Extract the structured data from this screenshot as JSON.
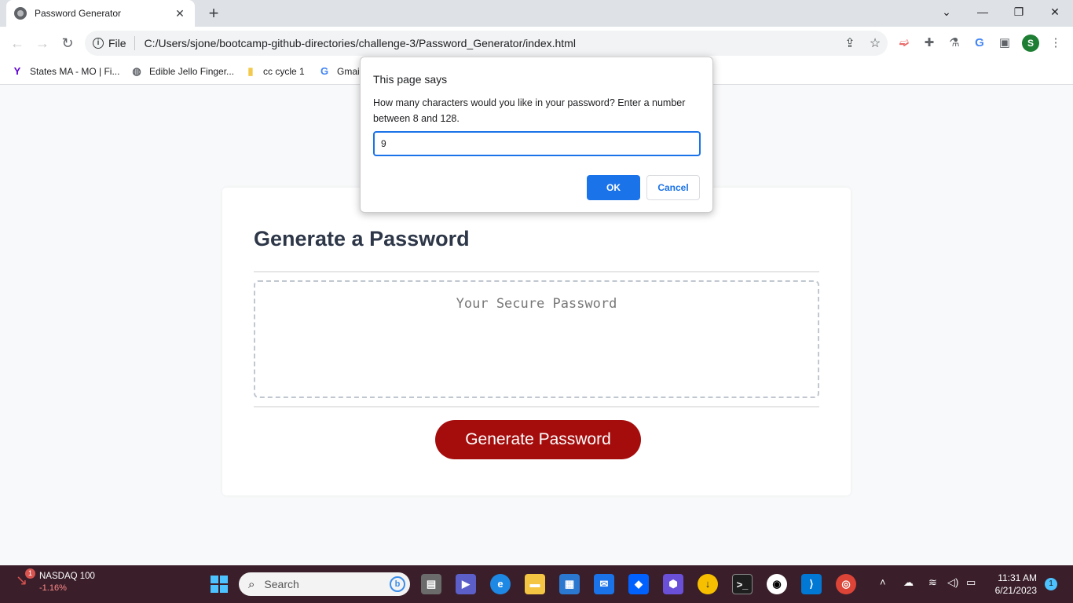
{
  "browser": {
    "tab_title": "Password Generator",
    "tab_close": "✕",
    "new_tab": "+",
    "url_scheme_label": "File",
    "url": "C:/Users/sjone/bootcamp-github-directories/challenge-3/Password_Generator/index.html",
    "profile_initial": "S"
  },
  "bookmarks": [
    {
      "label": "States MA - MO | Fi...",
      "icon": "yahoo-icon"
    },
    {
      "label": "Edible Jello Finger...",
      "icon": "globe-icon"
    },
    {
      "label": "cc cycle 1",
      "icon": "folder-icon"
    },
    {
      "label": "Gmail",
      "icon": "google-icon"
    }
  ],
  "page": {
    "heading": "Generate a Password",
    "password_placeholder": "Your Secure Password",
    "generate_button": "Generate Password"
  },
  "dialog": {
    "title": "This page says",
    "message": "How many characters would you like in your password? Enter a number between 8 and 128.",
    "input_value": "9",
    "ok_label": "OK",
    "cancel_label": "Cancel"
  },
  "taskbar": {
    "stock_name": "NASDAQ 100",
    "stock_change": "-1.16%",
    "stock_badge": "1",
    "search_label": "Search",
    "time": "11:31 AM",
    "date": "6/21/2023",
    "notification_count": "1"
  },
  "colors": {
    "primary_button": "#a50d0d",
    "dialog_accent": "#1a73e8",
    "taskbar_bg": "#3a1f2a"
  }
}
